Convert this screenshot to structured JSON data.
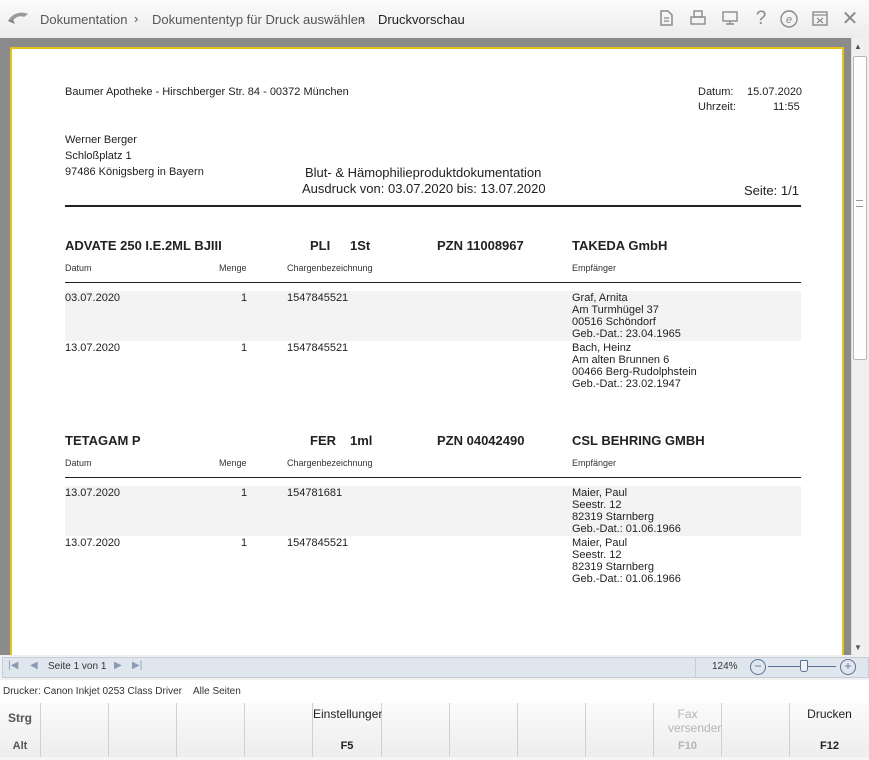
{
  "breadcrumb": {
    "items": [
      "Dokumentation",
      "Dokumententyp für Druck auswählen",
      "Druckvorschau"
    ],
    "separator": "›"
  },
  "toolbar_icons": [
    "document-icon",
    "printer-icon",
    "monitor-icon",
    "help-icon",
    "e-icon",
    "window-icon",
    "close-icon"
  ],
  "document": {
    "sender": "Baumer Apotheke - Hirschberger Str. 84 - 00372 München",
    "date_label": "Datum:",
    "date_value": "15.07.2020",
    "time_label": "Uhrzeit:",
    "time_value": "11:55",
    "recipient": [
      "Werner Berger",
      "Schloßplatz 1",
      "97486 Königsberg in Bayern"
    ],
    "title": "Blut- & Hämophilieproduktdokumentation",
    "subtitle": "Ausdruck von: 03.07.2020 bis: 13.07.2020",
    "page": "Seite: 1/1",
    "col_headers": {
      "date": "Datum",
      "qty": "Menge",
      "batch": "Chargenbezeichnung",
      "recipient": "Empfänger"
    },
    "products": [
      {
        "name": "ADVATE 250 I.E.2ML BJIII",
        "form": "PLI",
        "size": "1St",
        "pzn": "PZN 11008967",
        "maker": "TAKEDA GmbH",
        "rows": [
          {
            "date": "03.07.2020",
            "qty": "1",
            "batch": "1547845521",
            "recipient": [
              "Graf, Arnita",
              "Am Turmhügel 37",
              "00516 Schöndorf",
              "Geb.-Dat.: 23.04.1965"
            ]
          },
          {
            "date": "13.07.2020",
            "qty": "1",
            "batch": "1547845521",
            "recipient": [
              "Bach, Heinz",
              "Am alten Brunnen 6",
              "00466 Berg-Rudolphstein",
              "Geb.-Dat.: 23.02.1947"
            ]
          }
        ]
      },
      {
        "name": "TETAGAM P",
        "form": "FER",
        "size": "1ml",
        "pzn": "PZN 04042490",
        "maker": "CSL BEHRING GMBH",
        "rows": [
          {
            "date": "13.07.2020",
            "qty": "1",
            "batch": "154781681",
            "recipient": [
              "Maier, Paul",
              "Seestr. 12",
              "82319 Starnberg",
              "Geb.-Dat.: 01.06.1966"
            ]
          },
          {
            "date": "13.07.2020",
            "qty": "1",
            "batch": "1547845521",
            "recipient": [
              "Maier, Paul",
              "Seestr. 12",
              "82319 Starnberg",
              "Geb.-Dat.: 01.06.1966"
            ]
          }
        ]
      }
    ]
  },
  "nav": {
    "page_label": "Seite 1 von 1",
    "zoom": "124%",
    "zoom_level_percent": 124
  },
  "printer": {
    "label": "Drucker: Canon Inkjet 0253 Class Driver",
    "pages": "Alle Seiten"
  },
  "fkeys": {
    "strg": "Strg",
    "alt": "Alt",
    "settings_label": "Einstellungen",
    "settings_key": "F5",
    "fax_label": "Fax versenden",
    "fax_key": "F10",
    "print_label": "Drucken",
    "print_key": "F12"
  },
  "colors": {
    "page_border": "#e7c31a",
    "accent": "#3a7bd5"
  }
}
